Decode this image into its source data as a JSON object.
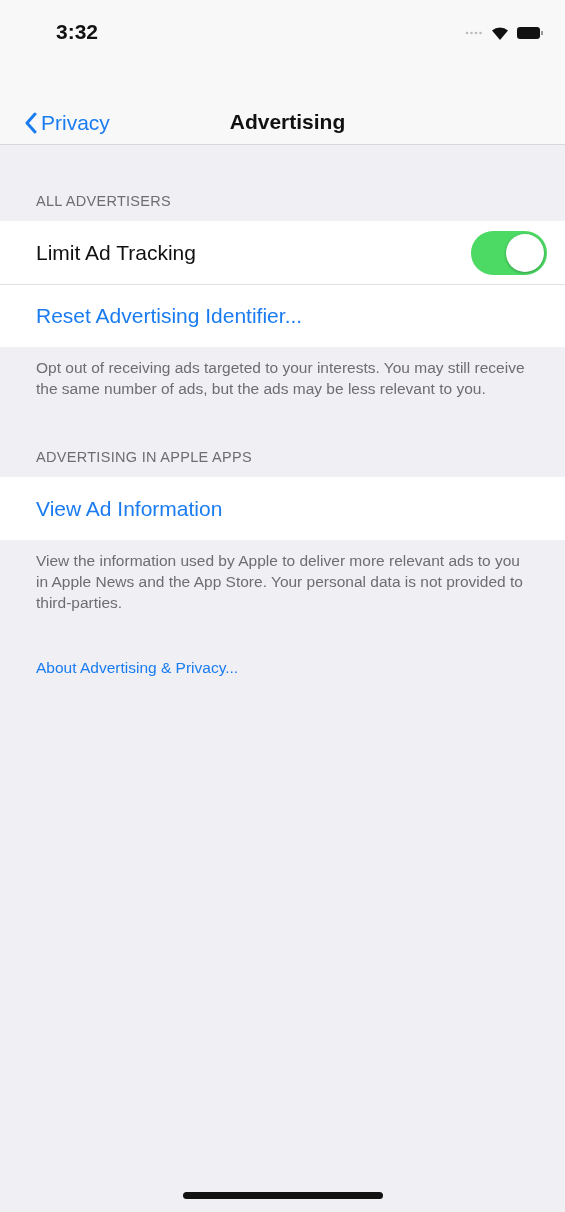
{
  "status_bar": {
    "time": "3:32"
  },
  "nav": {
    "back_label": "Privacy",
    "title": "Advertising"
  },
  "sections": [
    {
      "header": "ALL ADVERTISERS",
      "rows": [
        {
          "kind": "toggle",
          "label": "Limit Ad Tracking",
          "on": true
        },
        {
          "kind": "link",
          "label": "Reset Advertising Identifier..."
        }
      ],
      "footer": "Opt out of receiving ads targeted to your interests. You may still receive the same number of ads, but the ads may be less relevant to you."
    },
    {
      "header": "ADVERTISING IN APPLE APPS",
      "rows": [
        {
          "kind": "link",
          "label": "View Ad Information"
        }
      ],
      "footer": "View the information used by Apple to deliver more relevant ads to you in Apple News and the App Store. Your personal data is not provided to third-parties."
    }
  ],
  "about_link": "About Advertising & Privacy..."
}
